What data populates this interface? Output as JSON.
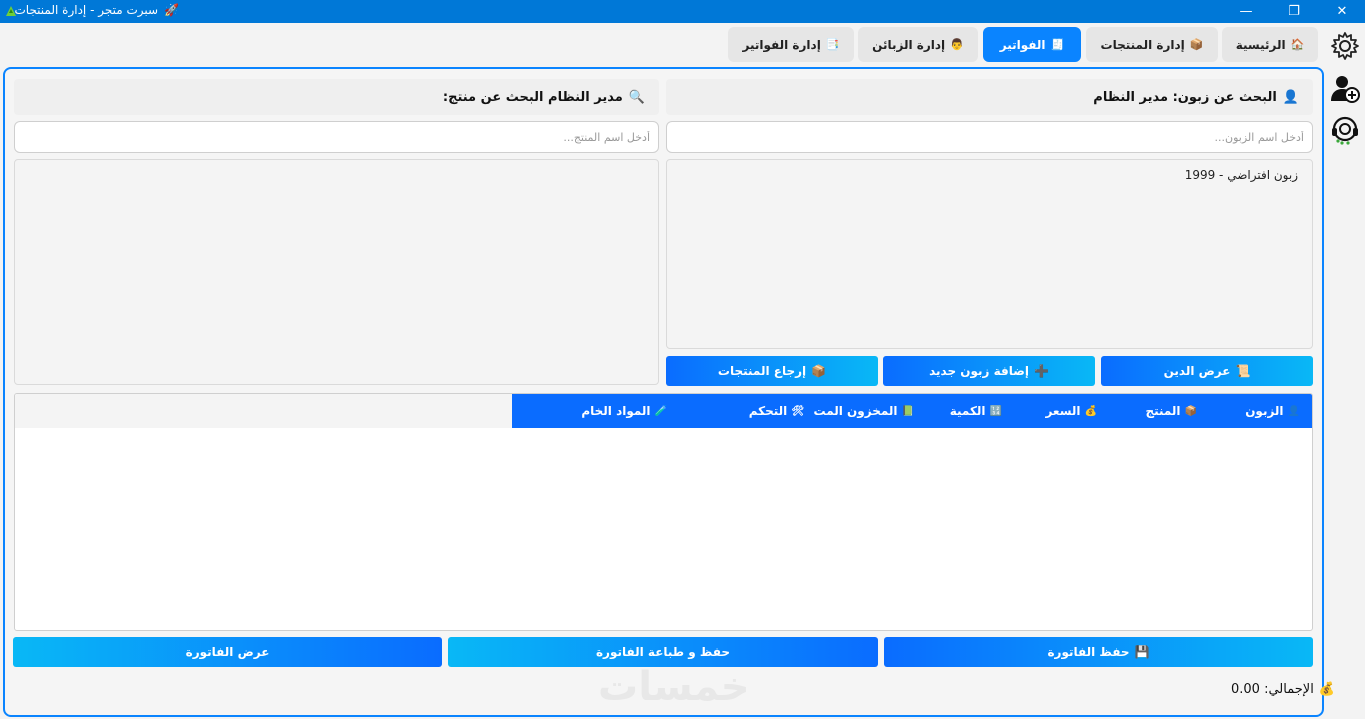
{
  "window": {
    "title": "سبرت متجر - إدارة المنتجات",
    "minimize": "—",
    "maximize": "❐",
    "close": "✕"
  },
  "tabs": [
    {
      "label": "الرئيسية",
      "icon": "🏠"
    },
    {
      "label": "إدارة المنتجات",
      "icon": "📦"
    },
    {
      "label": "الفواتير",
      "icon": "🧾"
    },
    {
      "label": "إدارة الزبائن",
      "icon": "👨"
    },
    {
      "label": "إدارة الفواتير",
      "icon": "📑"
    }
  ],
  "customer_panel": {
    "header": "البحث عن زبون: مدير النظام",
    "header_icon": "👤",
    "placeholder": "أدخل اسم الزبون...",
    "items": [
      "زبون افتراضي - 1999"
    ]
  },
  "product_panel": {
    "header": "مدير النظام البحث عن منتج:",
    "header_icon": "🔍",
    "placeholder": "أدخل اسم المنتج..."
  },
  "buttons": {
    "debt": {
      "label": "عرض الدين",
      "icon": "📜"
    },
    "new_customer": {
      "label": "إضافة زبون جديد",
      "icon": "➕"
    },
    "return_products": {
      "label": "إرجاع المنتجات",
      "icon": "📦"
    },
    "save_invoice": {
      "label": "حفظ الفاتورة",
      "icon": "💾"
    },
    "save_print": {
      "label": "حفظ و طباعة الفاتورة"
    },
    "view_invoice": {
      "label": "عرض الفاتورة"
    }
  },
  "table": {
    "columns": [
      {
        "label": "الزبون",
        "icon": "👤"
      },
      {
        "label": "المنتج",
        "icon": "📦"
      },
      {
        "label": "السعر",
        "icon": "💰"
      },
      {
        "label": "الكمية",
        "icon": "🔢"
      },
      {
        "label": "المخزون المت",
        "icon": "📗"
      },
      {
        "label": "التحكم",
        "icon": "🛠"
      },
      {
        "label": "المواد الخام",
        "icon": "🧪"
      }
    ],
    "rows": []
  },
  "total": {
    "label": "الإجمالي: 0.00",
    "icon": "💰"
  },
  "watermark": "خمسات",
  "colors": {
    "accent": "#0a84ff",
    "titlebar": "#0078d7",
    "header_row": "#0a6cff"
  }
}
